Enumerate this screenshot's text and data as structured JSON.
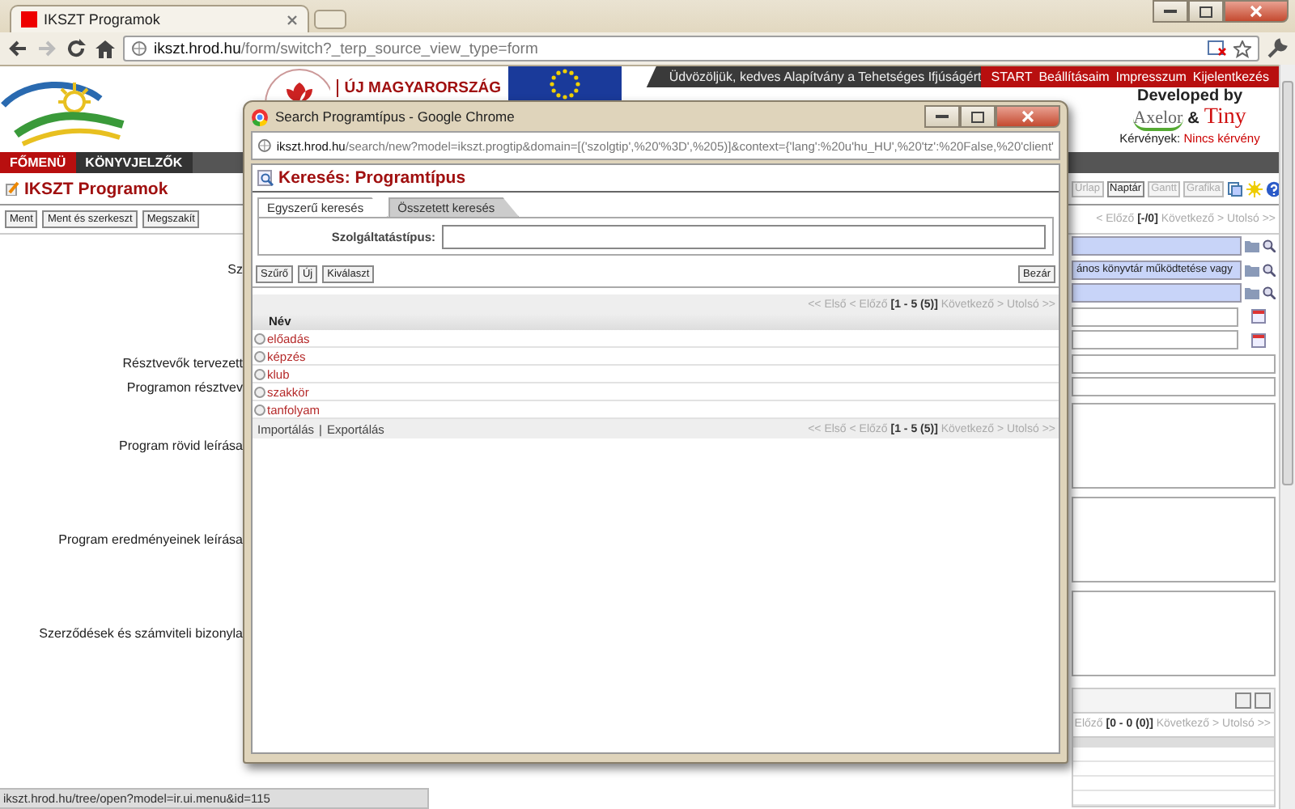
{
  "browser": {
    "tab_title": "IKSZT Programok",
    "url_host": "ikszt.hrod.hu",
    "url_path": "/form/switch?_terp_source_view_type=form"
  },
  "header": {
    "banner_title": "ÚJ MAGYARORSZÁG",
    "welcome": "Üdvözöljük, kedves Alapítvány a Tehetséges Ifjúságért",
    "links": [
      "START",
      "Beállításaim",
      "Impresszum",
      "Kijelentkezés"
    ],
    "developed_by": "Developed by",
    "axelor": "Axelor",
    "amp": "&",
    "tiny": "Tiny",
    "requests_label": "Kérvények:",
    "requests_value": "Nincs kérvény"
  },
  "menu": [
    {
      "label": "FŐMENÜ",
      "selected": true
    },
    {
      "label": "KÖNYVJELZŐK",
      "selected": false
    }
  ],
  "page": {
    "title": "IKSZT Programok",
    "buttons": [
      "Ment",
      "Ment és szerkeszt",
      "Megszakít"
    ],
    "view_buttons": [
      {
        "label": "Űrlap",
        "disabled": true
      },
      {
        "label": "Naptár",
        "disabled": false
      },
      {
        "label": "Gantt",
        "disabled": true
      },
      {
        "label": "Grafika",
        "disabled": true
      }
    ],
    "pager": "< Előző **[-/0]** Következő > Utolsó >>",
    "form_rows": [
      {
        "kind": "lookup"
      },
      {
        "kind": "lookup",
        "label": "Sz",
        "value": "ános könyvtár működtetése vagy"
      },
      {
        "kind": "lookup"
      },
      {
        "kind": "date"
      },
      {
        "kind": "date"
      },
      {
        "kind": "text",
        "label": "Résztvevők tervezett"
      },
      {
        "kind": "text",
        "label": "Programon résztvev"
      },
      {
        "kind": "textarea",
        "label": "Program rövid leírása"
      },
      {
        "kind": "textarea",
        "label": "Program eredményeinek leírása"
      },
      {
        "kind": "textarea",
        "label": "Szerződések és számviteli bizonyla"
      }
    ],
    "sub_pager": "Előző **[0 - 0 (0)]** Következő > Utolsó >>"
  },
  "popup": {
    "window_title": "Search Programtípus - Google Chrome",
    "url_host": "ikszt.hrod.hu",
    "url_path": "/search/new?model=ikszt.progtip&domain=[('szolgtip',%20'%3D',%205)]&context={'lang':%20u'hu_HU',%20'tz':%20False,%20'client'",
    "heading": "Keresés: Programtípus",
    "tabs": [
      {
        "label": "Egyszerű keresés",
        "selected": true
      },
      {
        "label": "Összetett keresés",
        "selected": false
      }
    ],
    "field_label": "Szolgáltatástípus:",
    "buttons": [
      "Szűrő",
      "Új",
      "Kiválaszt"
    ],
    "close_button": "Bezár",
    "pager": "<< Első < Előző **[1 - 5 (5)]** Következő > Utolsó >>",
    "column": "Név",
    "rows": [
      {
        "name": "előadás",
        "selected": false
      },
      {
        "name": "képzés",
        "selected": false
      },
      {
        "name": "klub",
        "selected": false
      },
      {
        "name": "szakkör",
        "selected": false
      },
      {
        "name": "tanfolyam",
        "selected": false
      }
    ],
    "footer_links": [
      "Importálás",
      "Exportálás"
    ],
    "footer_separator": "|",
    "footer_pager": "<< Első < Előző **[1 - 5 (5)]** Következő > Utolsó >>"
  },
  "status_bar": "ikszt.hrod.hu/tree/open?model=ir.ui.menu&id=115"
}
